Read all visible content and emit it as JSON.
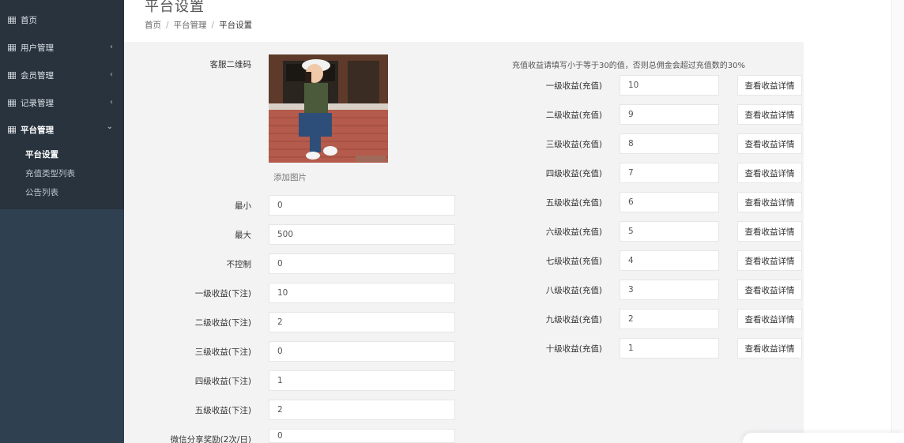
{
  "sidebar": {
    "items": [
      {
        "label": "首页",
        "icon": "grid-icon"
      },
      {
        "label": "用户管理",
        "icon": "grid-icon",
        "chevron": "‹"
      },
      {
        "label": "会员管理",
        "icon": "grid-icon",
        "chevron": "‹"
      },
      {
        "label": "记录管理",
        "icon": "grid-icon",
        "chevron": "‹"
      },
      {
        "label": "平台管理",
        "icon": "grid-icon",
        "chevron": "⌄"
      }
    ],
    "subitems": [
      {
        "label": "平台设置"
      },
      {
        "label": "充值类型列表"
      },
      {
        "label": "公告列表"
      }
    ]
  },
  "header": {
    "title": "平台设置",
    "breadcrumb": [
      "首页",
      "平台管理",
      "平台设置"
    ]
  },
  "left_form": {
    "qr_label": "客服二维码",
    "add_image": "添加图片",
    "fields": [
      {
        "label": "最小",
        "value": "0"
      },
      {
        "label": "最大",
        "value": "500"
      },
      {
        "label": "不控制",
        "value": "0"
      },
      {
        "label": "一级收益(下注)",
        "value": "10"
      },
      {
        "label": "二级收益(下注)",
        "value": "2"
      },
      {
        "label": "三级收益(下注)",
        "value": "0"
      },
      {
        "label": "四级收益(下注)",
        "value": "1"
      },
      {
        "label": "五级收益(下注)",
        "value": "2"
      },
      {
        "label": "微信分享奖励(2次/日)",
        "value": "0"
      }
    ]
  },
  "right_form": {
    "notice": "充值收益请填写小于等于30的值，否则总佣金会超过充值数的30%",
    "button_label": "查看收益详情",
    "fields": [
      {
        "label": "一级收益(充值)",
        "value": "10"
      },
      {
        "label": "二级收益(充值)",
        "value": "9"
      },
      {
        "label": "三级收益(充值)",
        "value": "8"
      },
      {
        "label": "四级收益(充值)",
        "value": "7"
      },
      {
        "label": "五级收益(充值)",
        "value": "6"
      },
      {
        "label": "六级收益(充值)",
        "value": "5"
      },
      {
        "label": "七级收益(充值)",
        "value": "4"
      },
      {
        "label": "八级收益(充值)",
        "value": "3"
      },
      {
        "label": "九级收益(充值)",
        "value": "2"
      },
      {
        "label": "十级收益(充值)",
        "value": "1"
      }
    ]
  },
  "colors": {
    "sidebar_bg": "#2f4050",
    "sidebar_top_bg": "#28333e",
    "panel_bg": "#f3f3f4"
  }
}
